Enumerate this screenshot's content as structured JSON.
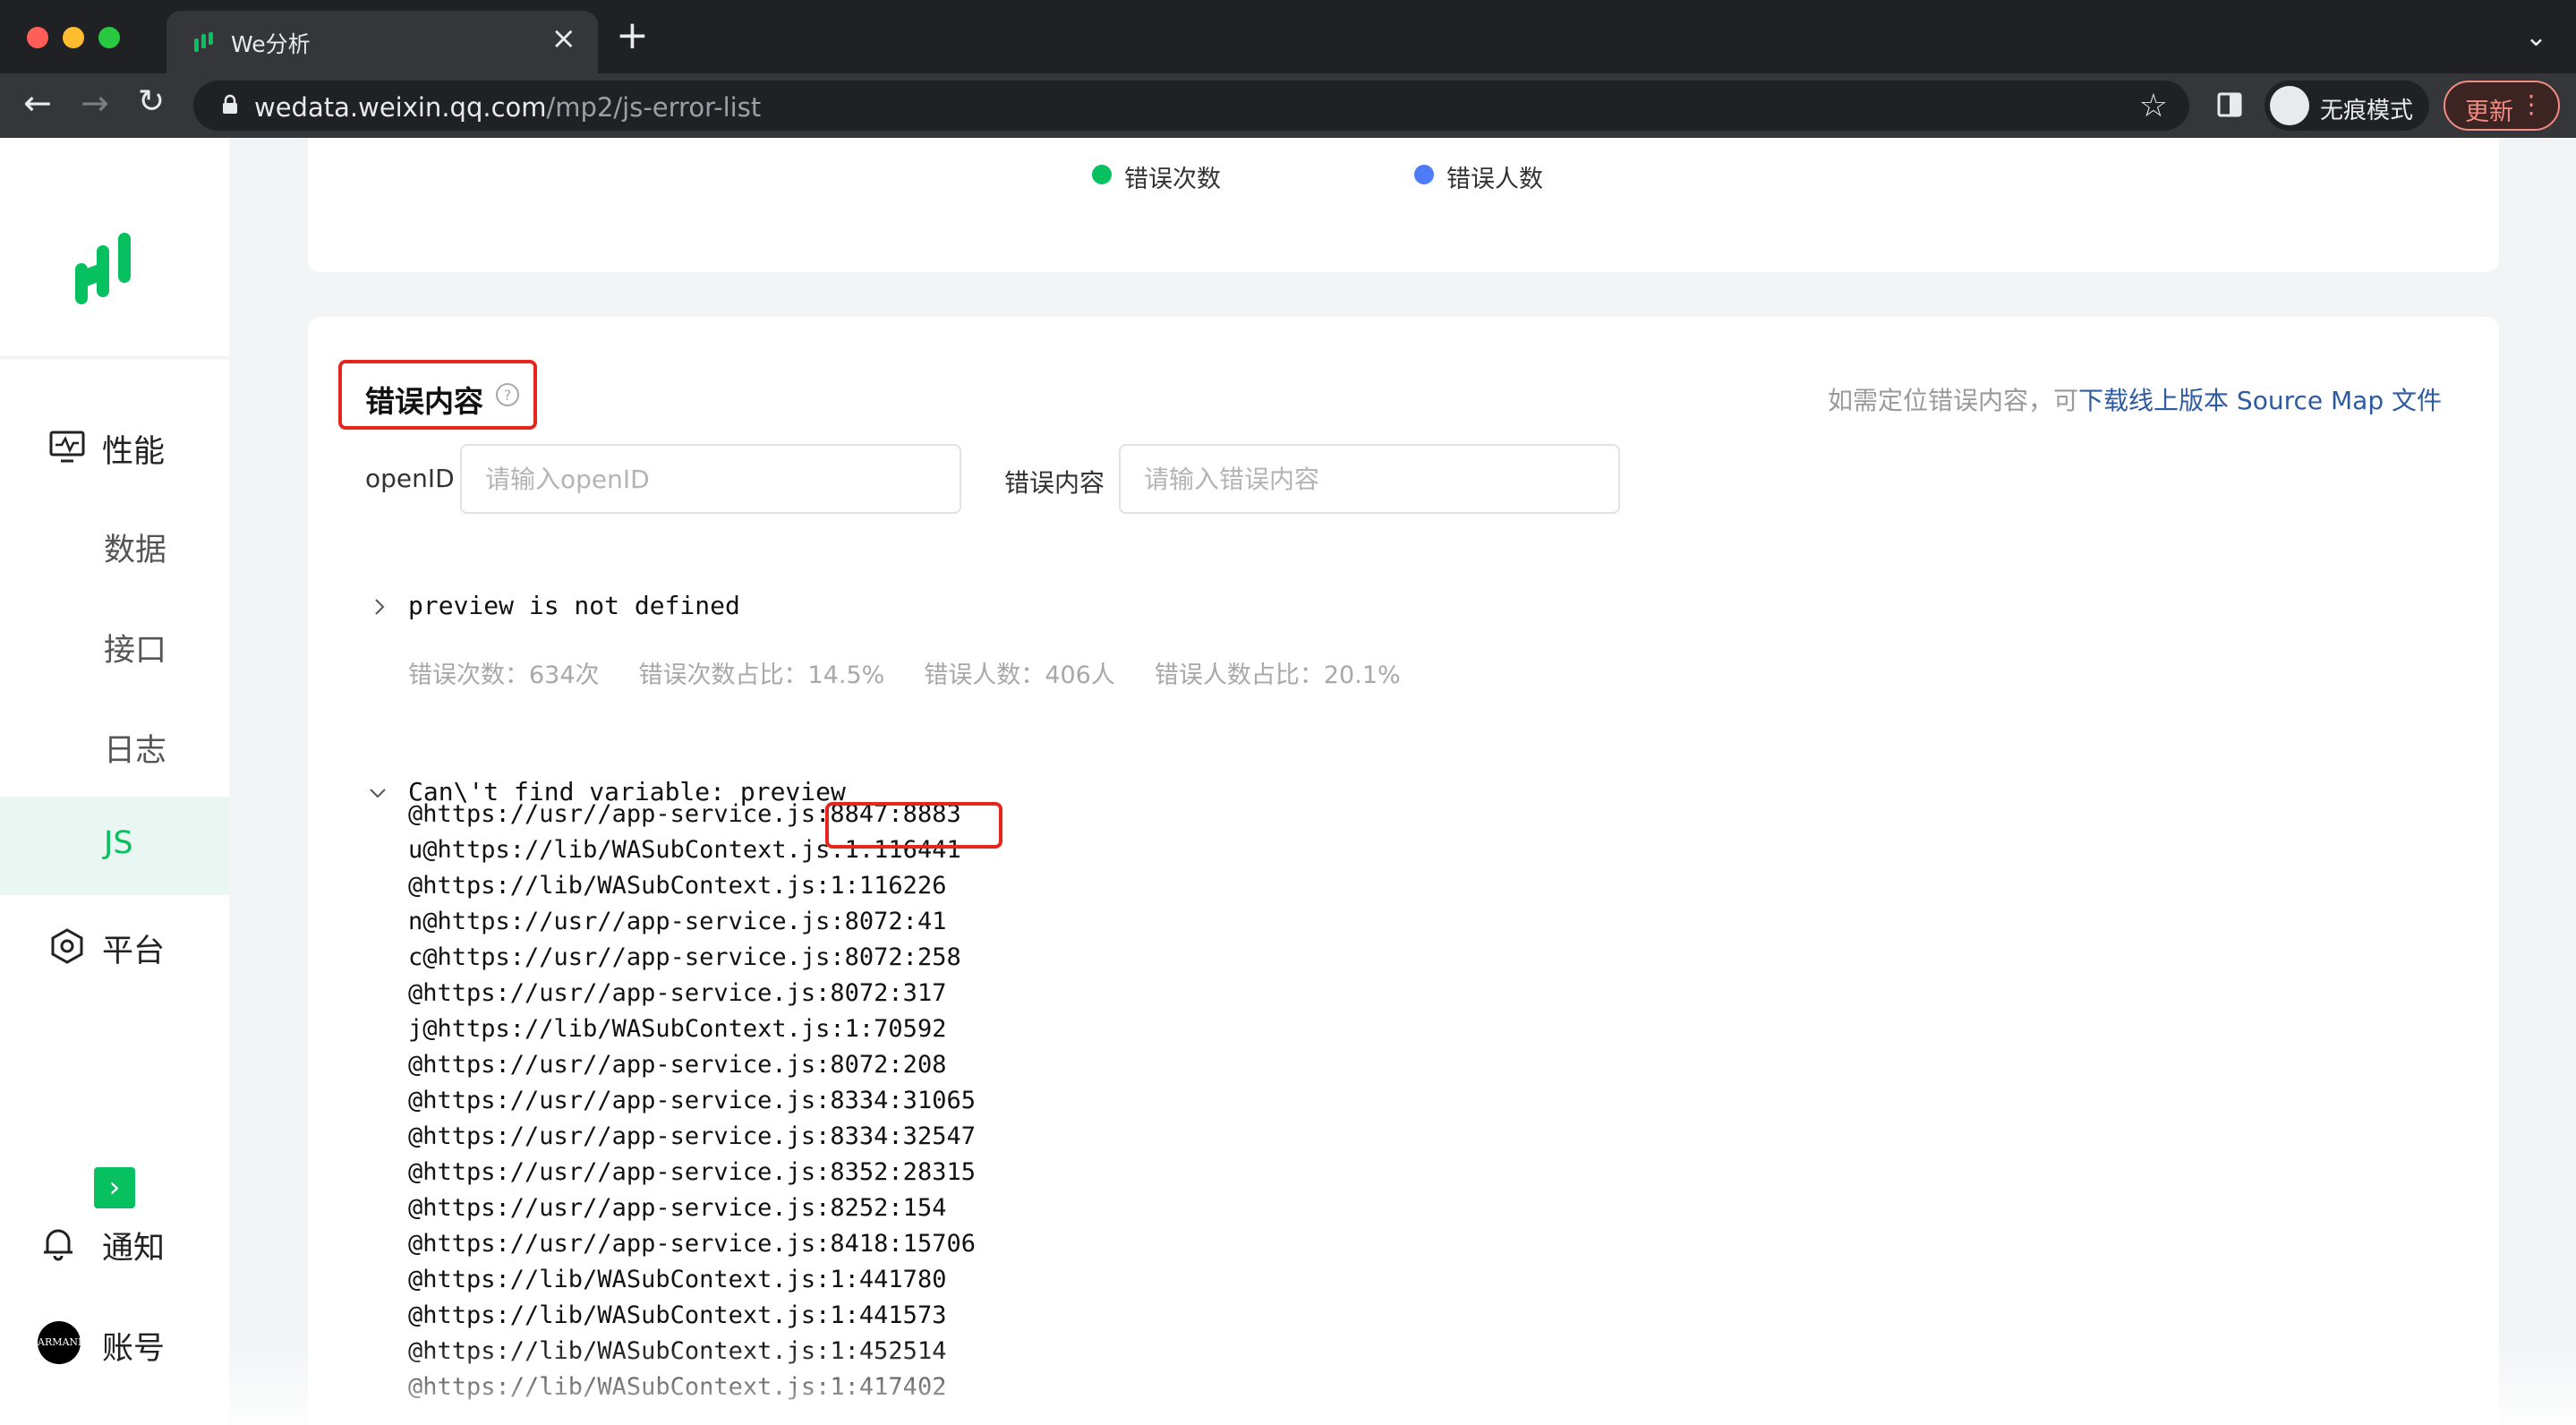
{
  "browser": {
    "tab_title": "We分析",
    "url_host": "wedata.weixin.qq.com",
    "url_path": "/mp2/js-error-list",
    "incognito_label": "无痕模式",
    "update_label": "更新"
  },
  "sidebar": {
    "items": [
      {
        "label": "性能",
        "icon": "monitor-icon"
      },
      {
        "label": "数据"
      },
      {
        "label": "接口"
      },
      {
        "label": "日志"
      },
      {
        "label": "JS",
        "active": true
      },
      {
        "label": "平台",
        "icon": "hexagon-icon"
      },
      {
        "label": "通知",
        "icon": "bell-icon"
      },
      {
        "label": "账号",
        "icon": "avatar"
      }
    ],
    "avatar_text": "ARMANI",
    "accent_color": "#07c160"
  },
  "legend": {
    "error_count": "错误次数",
    "error_count_color": "#07c160",
    "error_users": "错误人数",
    "error_users_color": "#4e7cf6"
  },
  "error_section": {
    "title": "错误内容",
    "hint_prefix": "如需定位错误内容，可",
    "hint_link": "下载线上版本 Source Map 文件",
    "openid_label": "openID",
    "openid_placeholder": "请输入openID",
    "content_label": "错误内容",
    "content_placeholder": "请输入错误内容"
  },
  "errors": [
    {
      "message": "preview is not defined",
      "expanded": false,
      "stats": {
        "count": "错误次数：634次",
        "count_ratio": "错误次数占比：14.5%",
        "users": "错误人数：406人",
        "users_ratio": "错误人数占比：20.1%"
      }
    },
    {
      "message": "Can\\'t find variable: preview",
      "expanded": true,
      "stack": [
        "@https://usr//app-service.js:8847:8883",
        "u@https://lib/WASubContext.js:1:116441",
        "@https://lib/WASubContext.js:1:116226",
        "n@https://usr//app-service.js:8072:41",
        "c@https://usr//app-service.js:8072:258",
        "@https://usr//app-service.js:8072:317",
        "j@https://lib/WASubContext.js:1:70592",
        "@https://usr//app-service.js:8072:208",
        "@https://usr//app-service.js:8334:31065",
        "@https://usr//app-service.js:8334:32547",
        "@https://usr//app-service.js:8352:28315",
        "@https://usr//app-service.js:8252:154",
        "@https://usr//app-service.js:8418:15706",
        "@https://lib/WASubContext.js:1:441780",
        "@https://lib/WASubContext.js:1:441573",
        "@https://lib/WASubContext.js:1:452514",
        "@https://lib/WASubContext.js:1:417402"
      ]
    }
  ]
}
